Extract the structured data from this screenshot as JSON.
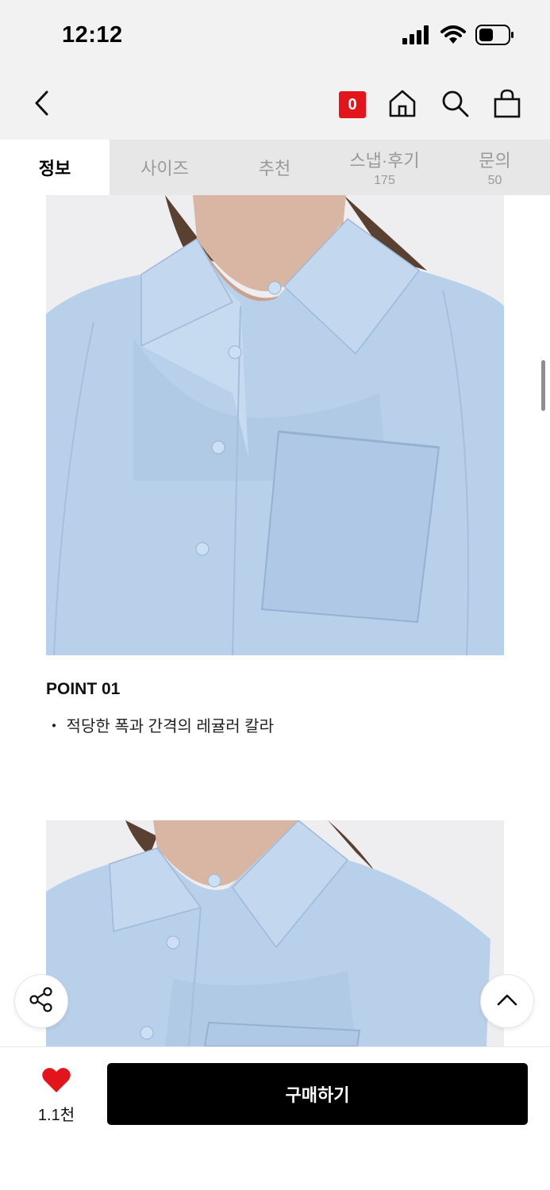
{
  "status_bar": {
    "time": "12:12",
    "icons": [
      "signal-icon",
      "wifi-icon",
      "battery-icon"
    ]
  },
  "top_nav": {
    "back_icon": "chevron-left-icon",
    "cart_badge": "0",
    "icons": [
      "home-icon",
      "search-icon",
      "shopping-bag-icon"
    ]
  },
  "tabs": [
    {
      "label": "정보",
      "count": "",
      "active": true
    },
    {
      "label": "사이즈",
      "count": ""
    },
    {
      "label": "추천",
      "count": ""
    },
    {
      "label": "스냅·후기",
      "count": "175"
    },
    {
      "label": "문의",
      "count": "50"
    }
  ],
  "content": {
    "point_title": "POINT 01",
    "point_desc": "・ 적당한 폭과 간격의 레귤러 칼라"
  },
  "floating": {
    "share_icon": "share-icon",
    "top_icon": "chevron-up-icon"
  },
  "bottom_bar": {
    "like_icon": "heart-icon",
    "like_count": "1.1천",
    "buy_label": "구매하기"
  },
  "colors": {
    "badge": "#e3141b",
    "heart": "#e3141b",
    "buy_button": "#000000",
    "shirt": "#b9d0ea"
  }
}
